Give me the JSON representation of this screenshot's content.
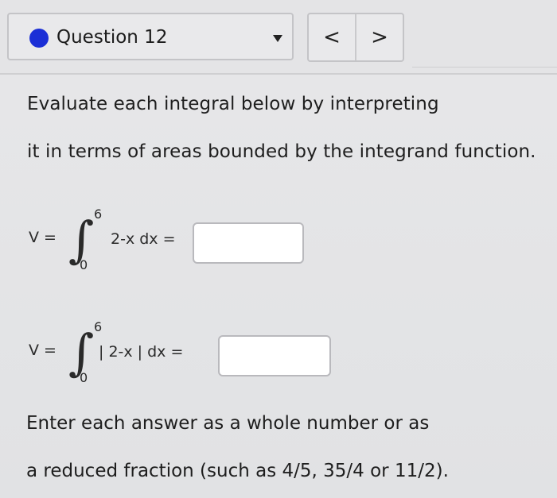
{
  "header": {
    "question_label": "Question 12",
    "status_color": "#1b2fd6",
    "nav_prev": "<",
    "nav_next": ">"
  },
  "prompt": {
    "line1": "Evaluate each integral below by interpreting",
    "line2": "it in terms of areas bounded by the integrand function."
  },
  "equations": [
    {
      "lhs": "V =",
      "upper": "6",
      "lower": "0",
      "integrand": "2-x dx =",
      "answer_value": ""
    },
    {
      "lhs": "V =",
      "upper": "6",
      "lower": "0",
      "integrand": "| 2-x | dx =",
      "answer_value": ""
    }
  ],
  "instructions": {
    "line1": "Enter each answer as a whole number or as",
    "line2": "a reduced fraction (such as 4/5, 35/4 or 11/2)."
  }
}
